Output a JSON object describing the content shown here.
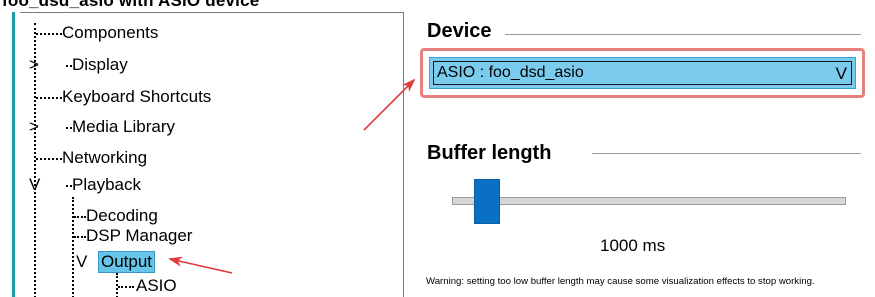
{
  "caption": "foo_dsd_asio with ASIO device",
  "tree": {
    "items": [
      {
        "label": "Components"
      },
      {
        "label": "Display"
      },
      {
        "label": "Keyboard Shortcuts"
      },
      {
        "label": "Media Library"
      },
      {
        "label": "Networking"
      },
      {
        "label": "Playback"
      },
      {
        "label": "Decoding"
      },
      {
        "label": "DSP Manager"
      },
      {
        "label": "Output"
      },
      {
        "label": "ASIO"
      }
    ],
    "selected": "Output"
  },
  "device": {
    "title": "Device",
    "selected_value": "ASIO : foo_dsd_asio"
  },
  "buffer": {
    "title": "Buffer length",
    "value_label": "1000 ms",
    "slider_position": 0.06
  },
  "warning": "Warning: setting too low buffer length may cause some visualization effects to stop working.",
  "colors": {
    "selection": "#66c5e8",
    "highlight_border": "#e8807e",
    "arrow": "#e03a3a",
    "slider_thumb": "#0a70c4",
    "accent": "#1aa0a8"
  }
}
